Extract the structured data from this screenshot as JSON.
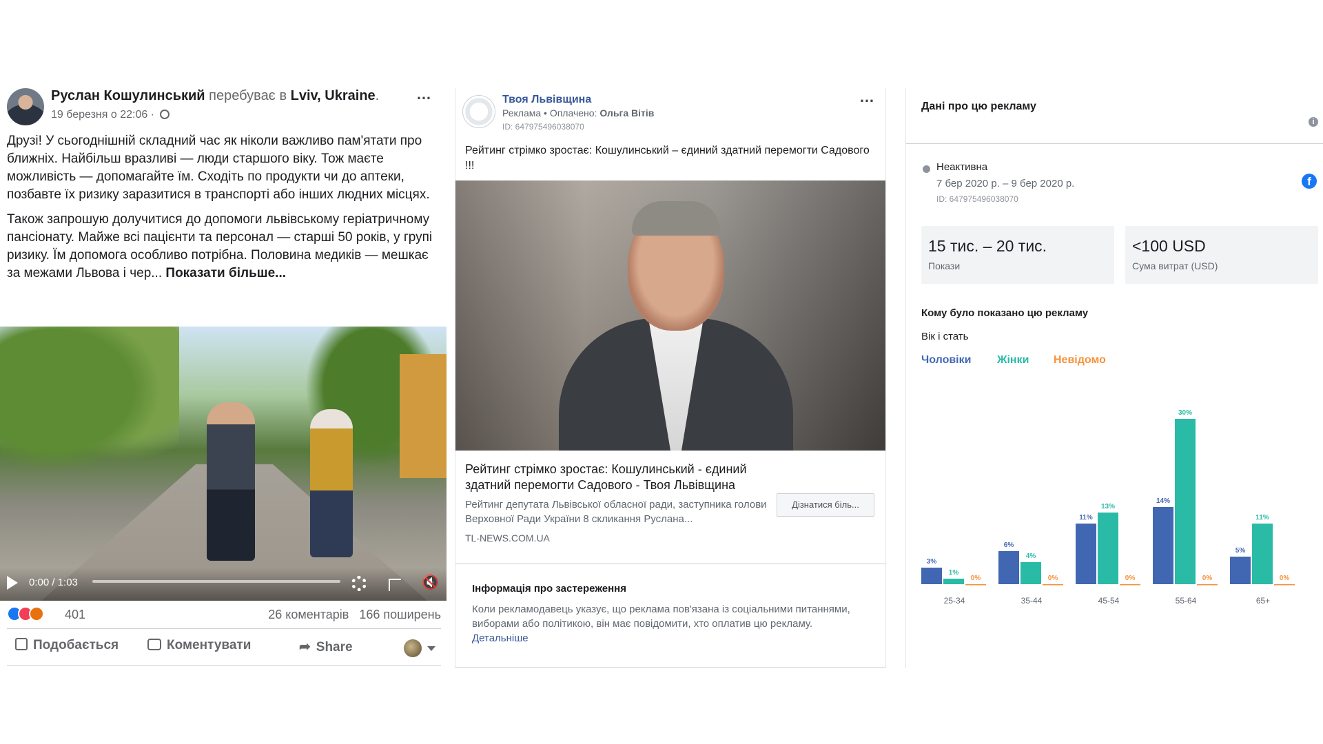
{
  "post": {
    "author": "Руслан Кошулинський",
    "location_prefix": "перебуває в",
    "location": "Lviv, Ukraine",
    "location_suffix": ".",
    "date": "19 березня о 22:06 ·",
    "more_icon": "…",
    "paragraph1": "Друзі! У сьогоднішній складний час як ніколи важливо пам'ятати про ближніх. Найбільш вразливі — люди старшого віку. Тож маєте можливість — допомагайте їм. Сходіть по продукти чи до аптеки, позбавте їх ризику заразитися в транспорті або інших людних місцях.",
    "paragraph2": "Також запрошую долучитися до допомоги львівському геріатричному пансіонату. Майже всі пацієнти та персонал — старші 50 років, у групі ризику. Їм допомога особливо потрібна. Половина медиків — мешкає за межами Львова і чер...",
    "show_more": "Показати більше...",
    "video_time": "0:00 / 1:03",
    "reactions_count": "401",
    "comments": "26 коментарів",
    "shares": "166 поширень",
    "like_label": "Подобається",
    "comment_label": "Коментувати",
    "share_label": "Share",
    "share_arrow": "➦",
    "mute_glyph": "🔇"
  },
  "ad": {
    "page_name": "Твоя Львівщина",
    "sponsor_prefix": "Реклама • Оплачено:",
    "sponsor_name": "Ольга Вітів",
    "ad_id": "ID: 647975496038070",
    "more_icon": "…",
    "headline": "Рейтинг стрімко зростає: Кошулинський – єдиний здатний перемогти Садового !!!",
    "link_title": "Рейтинг стрімко зростає: Кошулинський - єдиний здатний перемогти Садового - Твоя Львівщина",
    "link_desc": "Рейтинг депутата Львівської обласної ради, заступника голови Верховної Ради України 8 скликання Руслана...",
    "domain": "TL-NEWS.COM.UA",
    "cta": "Дізнатися біль...",
    "disclaimer_title": "Інформація про застереження",
    "disclaimer_text": "Коли рекламодавець указує, що реклама пов'язана із соціальними питаннями, виборами або політикою, він має повідомити, хто оплатив цю рекламу.",
    "disclaimer_link": "Детальніше"
  },
  "ad_data": {
    "title": "Дані про цю рекламу",
    "info_glyph": "i",
    "fb_glyph": "f",
    "status": "Неактивна",
    "dates": "7 бер 2020 р. – 9 бер 2020 р.",
    "id": "ID: 647975496038070",
    "impressions_value": "15 тис. – 20 тис.",
    "impressions_label": "Покази",
    "spend_value": "<100 USD",
    "spend_label": "Сума витрат (USD)",
    "who_title": "Кому було показано цю рекламу",
    "age_sex_label": "Вік і стать",
    "colors": {
      "men": "#4267b2",
      "women": "#2abba7",
      "unknown": "#f7923b"
    }
  },
  "chart_data": {
    "type": "bar",
    "categories": [
      "25-34",
      "35-44",
      "45-54",
      "55-64",
      "65+"
    ],
    "series": [
      {
        "name": "Чоловіки",
        "values": [
          3,
          6,
          11,
          14,
          5
        ],
        "labels": [
          "3%",
          "6%",
          "11%",
          "14%",
          "5%"
        ]
      },
      {
        "name": "Жінки",
        "values": [
          1,
          4,
          13,
          30,
          11
        ],
        "labels": [
          "1%",
          "4%",
          "13%",
          "30%",
          "11%"
        ]
      },
      {
        "name": "Невідомо",
        "values": [
          0,
          0,
          0,
          0,
          0
        ],
        "labels": [
          "0%",
          "0%",
          "0%",
          "0%",
          "0%"
        ]
      }
    ],
    "ylim": [
      0,
      30
    ],
    "legend": "top-left",
    "grid": false
  }
}
